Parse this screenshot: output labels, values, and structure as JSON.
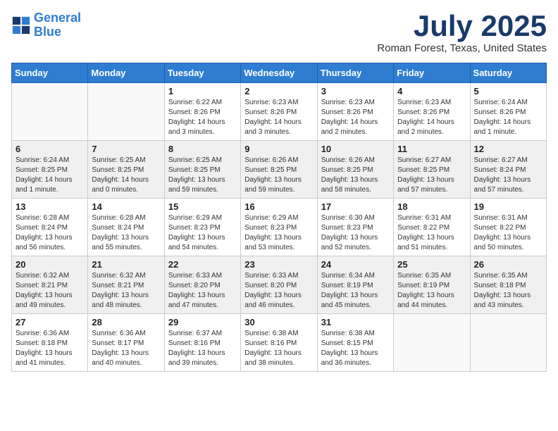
{
  "header": {
    "logo_line1": "General",
    "logo_line2": "Blue",
    "month_title": "July 2025",
    "location": "Roman Forest, Texas, United States"
  },
  "weekdays": [
    "Sunday",
    "Monday",
    "Tuesday",
    "Wednesday",
    "Thursday",
    "Friday",
    "Saturday"
  ],
  "weeks": [
    [
      {
        "day": "",
        "info": ""
      },
      {
        "day": "",
        "info": ""
      },
      {
        "day": "1",
        "info": "Sunrise: 6:22 AM\nSunset: 8:26 PM\nDaylight: 14 hours and 3 minutes."
      },
      {
        "day": "2",
        "info": "Sunrise: 6:23 AM\nSunset: 8:26 PM\nDaylight: 14 hours and 3 minutes."
      },
      {
        "day": "3",
        "info": "Sunrise: 6:23 AM\nSunset: 8:26 PM\nDaylight: 14 hours and 2 minutes."
      },
      {
        "day": "4",
        "info": "Sunrise: 6:23 AM\nSunset: 8:26 PM\nDaylight: 14 hours and 2 minutes."
      },
      {
        "day": "5",
        "info": "Sunrise: 6:24 AM\nSunset: 8:26 PM\nDaylight: 14 hours and 1 minute."
      }
    ],
    [
      {
        "day": "6",
        "info": "Sunrise: 6:24 AM\nSunset: 8:25 PM\nDaylight: 14 hours and 1 minute."
      },
      {
        "day": "7",
        "info": "Sunrise: 6:25 AM\nSunset: 8:25 PM\nDaylight: 14 hours and 0 minutes."
      },
      {
        "day": "8",
        "info": "Sunrise: 6:25 AM\nSunset: 8:25 PM\nDaylight: 13 hours and 59 minutes."
      },
      {
        "day": "9",
        "info": "Sunrise: 6:26 AM\nSunset: 8:25 PM\nDaylight: 13 hours and 59 minutes."
      },
      {
        "day": "10",
        "info": "Sunrise: 6:26 AM\nSunset: 8:25 PM\nDaylight: 13 hours and 58 minutes."
      },
      {
        "day": "11",
        "info": "Sunrise: 6:27 AM\nSunset: 8:25 PM\nDaylight: 13 hours and 57 minutes."
      },
      {
        "day": "12",
        "info": "Sunrise: 6:27 AM\nSunset: 8:24 PM\nDaylight: 13 hours and 57 minutes."
      }
    ],
    [
      {
        "day": "13",
        "info": "Sunrise: 6:28 AM\nSunset: 8:24 PM\nDaylight: 13 hours and 56 minutes."
      },
      {
        "day": "14",
        "info": "Sunrise: 6:28 AM\nSunset: 8:24 PM\nDaylight: 13 hours and 55 minutes."
      },
      {
        "day": "15",
        "info": "Sunrise: 6:29 AM\nSunset: 8:23 PM\nDaylight: 13 hours and 54 minutes."
      },
      {
        "day": "16",
        "info": "Sunrise: 6:29 AM\nSunset: 8:23 PM\nDaylight: 13 hours and 53 minutes."
      },
      {
        "day": "17",
        "info": "Sunrise: 6:30 AM\nSunset: 8:23 PM\nDaylight: 13 hours and 52 minutes."
      },
      {
        "day": "18",
        "info": "Sunrise: 6:31 AM\nSunset: 8:22 PM\nDaylight: 13 hours and 51 minutes."
      },
      {
        "day": "19",
        "info": "Sunrise: 6:31 AM\nSunset: 8:22 PM\nDaylight: 13 hours and 50 minutes."
      }
    ],
    [
      {
        "day": "20",
        "info": "Sunrise: 6:32 AM\nSunset: 8:21 PM\nDaylight: 13 hours and 49 minutes."
      },
      {
        "day": "21",
        "info": "Sunrise: 6:32 AM\nSunset: 8:21 PM\nDaylight: 13 hours and 48 minutes."
      },
      {
        "day": "22",
        "info": "Sunrise: 6:33 AM\nSunset: 8:20 PM\nDaylight: 13 hours and 47 minutes."
      },
      {
        "day": "23",
        "info": "Sunrise: 6:33 AM\nSunset: 8:20 PM\nDaylight: 13 hours and 46 minutes."
      },
      {
        "day": "24",
        "info": "Sunrise: 6:34 AM\nSunset: 8:19 PM\nDaylight: 13 hours and 45 minutes."
      },
      {
        "day": "25",
        "info": "Sunrise: 6:35 AM\nSunset: 8:19 PM\nDaylight: 13 hours and 44 minutes."
      },
      {
        "day": "26",
        "info": "Sunrise: 6:35 AM\nSunset: 8:18 PM\nDaylight: 13 hours and 43 minutes."
      }
    ],
    [
      {
        "day": "27",
        "info": "Sunrise: 6:36 AM\nSunset: 8:18 PM\nDaylight: 13 hours and 41 minutes."
      },
      {
        "day": "28",
        "info": "Sunrise: 6:36 AM\nSunset: 8:17 PM\nDaylight: 13 hours and 40 minutes."
      },
      {
        "day": "29",
        "info": "Sunrise: 6:37 AM\nSunset: 8:16 PM\nDaylight: 13 hours and 39 minutes."
      },
      {
        "day": "30",
        "info": "Sunrise: 6:38 AM\nSunset: 8:16 PM\nDaylight: 13 hours and 38 minutes."
      },
      {
        "day": "31",
        "info": "Sunrise: 6:38 AM\nSunset: 8:15 PM\nDaylight: 13 hours and 36 minutes."
      },
      {
        "day": "",
        "info": ""
      },
      {
        "day": "",
        "info": ""
      }
    ]
  ]
}
